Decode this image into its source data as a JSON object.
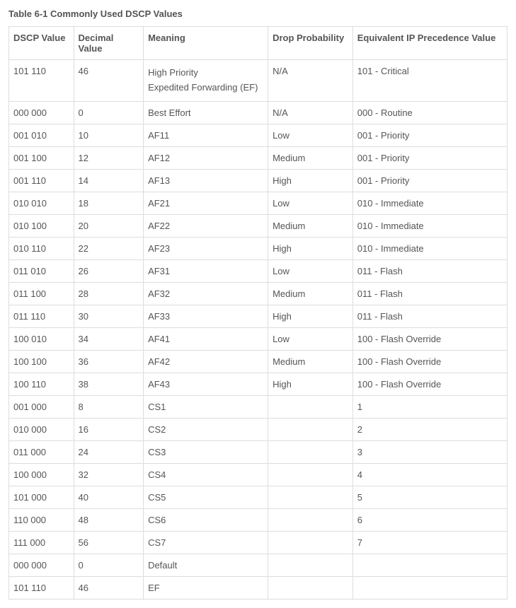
{
  "title": "Table 6-1 Commonly Used DSCP Values",
  "headers": {
    "dscp": "DSCP Value",
    "decimal": "Decimal Value",
    "meaning": "Meaning",
    "drop": "Drop Probability",
    "equiv": "Equivalent IP Precedence Value"
  },
  "rows": [
    {
      "dscp": "101 110",
      "decimal": "46",
      "meaning_lines": [
        "High Priority",
        "Expedited Forwarding (EF)"
      ],
      "drop": "N/A",
      "equiv": "101 - Critical"
    },
    {
      "dscp": "000 000",
      "decimal": "0",
      "meaning": "Best Effort",
      "drop": "N/A",
      "equiv": "000 - Routine"
    },
    {
      "dscp": "001 010",
      "decimal": "10",
      "meaning": "AF11",
      "drop": "Low",
      "equiv": "001 - Priority"
    },
    {
      "dscp": "001 100",
      "decimal": "12",
      "meaning": "AF12",
      "drop": "Medium",
      "equiv": "001 - Priority"
    },
    {
      "dscp": "001 110",
      "decimal": "14",
      "meaning": "AF13",
      "drop": "High",
      "equiv": "001 - Priority"
    },
    {
      "dscp": "010 010",
      "decimal": "18",
      "meaning": "AF21",
      "drop": "Low",
      "equiv": "010 - Immediate"
    },
    {
      "dscp": "010 100",
      "decimal": "20",
      "meaning": "AF22",
      "drop": "Medium",
      "equiv": "010 - Immediate"
    },
    {
      "dscp": "010 110",
      "decimal": "22",
      "meaning": "AF23",
      "drop": "High",
      "equiv": "010 - Immediate"
    },
    {
      "dscp": "011 010",
      "decimal": "26",
      "meaning": "AF31",
      "drop": "Low",
      "equiv": "011 - Flash"
    },
    {
      "dscp": "011 100",
      "decimal": "28",
      "meaning": "AF32",
      "drop": "Medium",
      "equiv": "011 - Flash"
    },
    {
      "dscp": "011 110",
      "decimal": "30",
      "meaning": "AF33",
      "drop": "High",
      "equiv": "011 - Flash"
    },
    {
      "dscp": "100 010",
      "decimal": "34",
      "meaning": "AF41",
      "drop": "Low",
      "equiv": "100 - Flash Override"
    },
    {
      "dscp": "100 100",
      "decimal": "36",
      "meaning": "AF42",
      "drop": "Medium",
      "equiv": "100 - Flash Override"
    },
    {
      "dscp": "100 110",
      "decimal": "38",
      "meaning": "AF43",
      "drop": "High",
      "equiv": "100 - Flash Override"
    },
    {
      "dscp": "001 000",
      "decimal": "8",
      "meaning": "CS1",
      "drop": "",
      "equiv": "1"
    },
    {
      "dscp": "010 000",
      "decimal": "16",
      "meaning": "CS2",
      "drop": "",
      "equiv": "2"
    },
    {
      "dscp": "011 000",
      "decimal": "24",
      "meaning": "CS3",
      "drop": "",
      "equiv": "3"
    },
    {
      "dscp": "100 000",
      "decimal": "32",
      "meaning": "CS4",
      "drop": "",
      "equiv": "4"
    },
    {
      "dscp": "101 000",
      "decimal": "40",
      "meaning": "CS5",
      "drop": "",
      "equiv": "5"
    },
    {
      "dscp": "110 000",
      "decimal": "48",
      "meaning": "CS6",
      "drop": "",
      "equiv": "6"
    },
    {
      "dscp": "111 000",
      "decimal": "56",
      "meaning": "CS7",
      "drop": "",
      "equiv": "7"
    },
    {
      "dscp": "000 000",
      "decimal": "0",
      "meaning": "Default",
      "drop": "",
      "equiv": ""
    },
    {
      "dscp": "101 110",
      "decimal": "46",
      "meaning": "EF",
      "drop": "",
      "equiv": ""
    }
  ]
}
